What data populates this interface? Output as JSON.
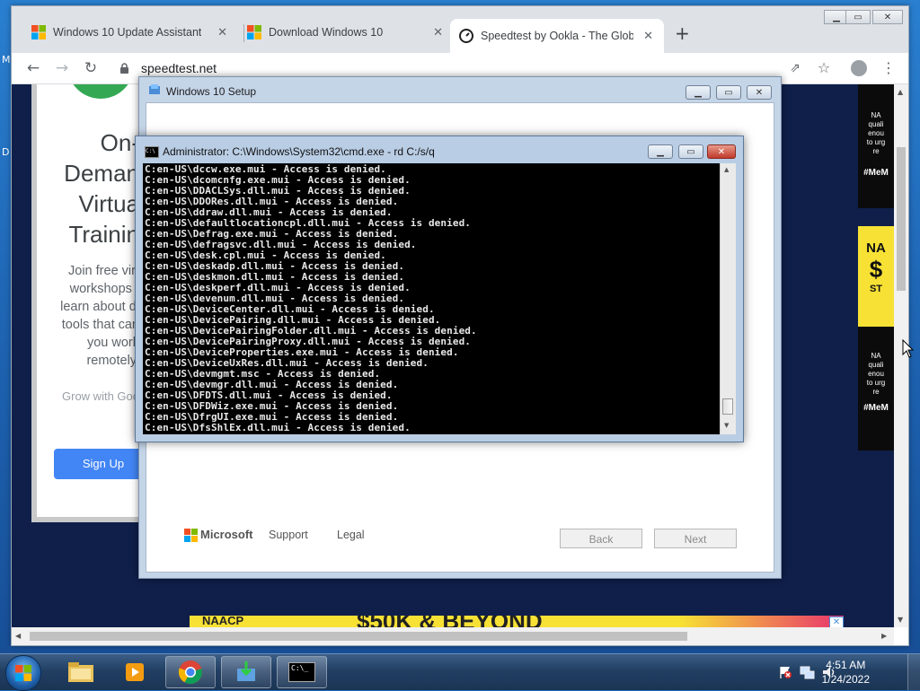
{
  "colors": {
    "chrome_tabstrip": "#dee1e6",
    "cmd_bg": "#000000",
    "signup_blue": "#4285f4",
    "naacp_yellow": "#f7e135",
    "naacp_pink": "#e8336d"
  },
  "browser": {
    "tabs": [
      {
        "label": "Windows 10 Update Assistant",
        "icon": "windows-logo-icon"
      },
      {
        "label": "Download Windows 10",
        "icon": "windows-logo-icon"
      },
      {
        "label": "Speedtest by Ookla - The Global",
        "icon": "speedtest-icon",
        "active": true
      }
    ],
    "url": "speedtest.net",
    "new_tab": "+"
  },
  "page": {
    "card_heading": [
      "On-",
      "Deman",
      "Virtua",
      "Trainin"
    ],
    "card_body": [
      "Join free virt",
      "workshops t",
      "learn about di",
      "tools that can",
      "you work",
      "remotely."
    ],
    "card_footer": "Grow with Goo",
    "signup": "Sign Up",
    "ad_right_top": [
      "NA",
      "quali",
      "enou",
      "to urg",
      "re"
    ],
    "ad_right_tag": "#MeM",
    "ad_right_mid": [
      "NA",
      "$",
      "ST"
    ],
    "ad_right_bottom": [
      "NA",
      "quali",
      "enou",
      "to urg",
      "re"
    ],
    "ad_right_tag2": "#MeM",
    "bottom_banner": [
      "NAACP",
      "$50K & BEYOND"
    ]
  },
  "setup": {
    "title": "Windows 10 Setup",
    "microsoft": "Microsoft",
    "support": "Support",
    "legal": "Legal",
    "back": "Back",
    "next": "Next"
  },
  "cmd": {
    "title": "Administrator: C:\\Windows\\System32\\cmd.exe - rd  C:/s/q",
    "lines": [
      "C:en-US\\dccw.exe.mui - Access is denied.",
      "C:en-US\\dcomcnfg.exe.mui - Access is denied.",
      "C:en-US\\DDACLSys.dll.mui - Access is denied.",
      "C:en-US\\DDORes.dll.mui - Access is denied.",
      "C:en-US\\ddraw.dll.mui - Access is denied.",
      "C:en-US\\defaultlocationcpl.dll.mui - Access is denied.",
      "C:en-US\\Defrag.exe.mui - Access is denied.",
      "C:en-US\\defragsvc.dll.mui - Access is denied.",
      "C:en-US\\desk.cpl.mui - Access is denied.",
      "C:en-US\\deskadp.dll.mui - Access is denied.",
      "C:en-US\\deskmon.dll.mui - Access is denied.",
      "C:en-US\\deskperf.dll.mui - Access is denied.",
      "C:en-US\\devenum.dll.mui - Access is denied.",
      "C:en-US\\DeviceCenter.dll.mui - Access is denied.",
      "C:en-US\\DevicePairing.dll.mui - Access is denied.",
      "C:en-US\\DevicePairingFolder.dll.mui - Access is denied.",
      "C:en-US\\DevicePairingProxy.dll.mui - Access is denied.",
      "C:en-US\\DeviceProperties.exe.mui - Access is denied.",
      "C:en-US\\DeviceUxRes.dll.mui - Access is denied.",
      "C:en-US\\devmgmt.msc - Access is denied.",
      "C:en-US\\devmgr.dll.mui - Access is denied.",
      "C:en-US\\DFDTS.dll.mui - Access is denied.",
      "C:en-US\\DFDWiz.exe.mui - Access is denied.",
      "C:en-US\\DfrgUI.exe.mui - Access is denied.",
      "C:en-US\\DfsShlEx.dll.mui - Access is denied."
    ]
  },
  "taskbar": {
    "time": "4:51 AM",
    "date": "1/24/2022",
    "cmd_icon_text": "C:\\_"
  },
  "desktop": {
    "left_letters": [
      "M",
      "D"
    ]
  }
}
